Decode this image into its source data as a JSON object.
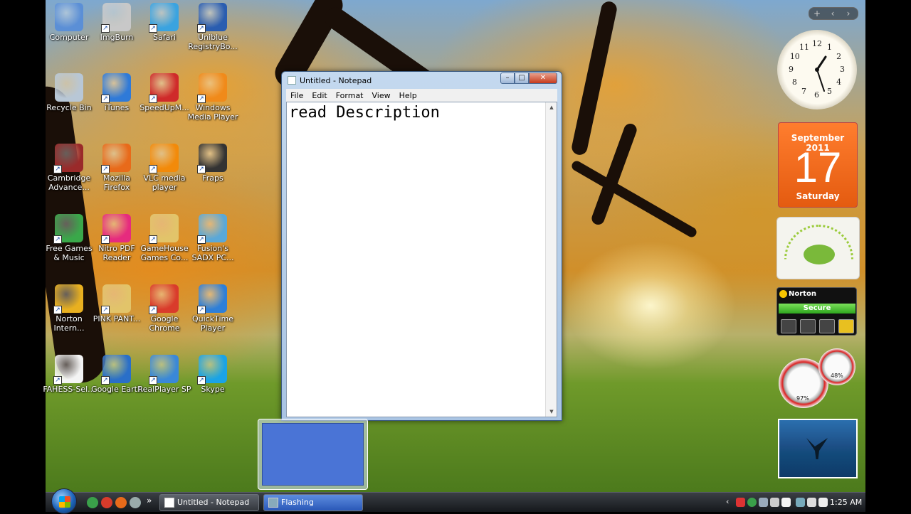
{
  "desktop": {
    "icons": [
      {
        "label": "Computer",
        "icon": "computer-icon",
        "color": "#5b8fd6"
      },
      {
        "label": "ImgBurn",
        "icon": "disc-icon",
        "color": "#c8c8c8"
      },
      {
        "label": "Safari",
        "icon": "compass-icon",
        "color": "#3aa3e0"
      },
      {
        "label": "Uniblue\nRegistryBo...",
        "icon": "shield-icon",
        "color": "#2a5db0"
      },
      {
        "label": "Recycle Bin",
        "icon": "recycle-bin-icon",
        "color": "#b8c7d6"
      },
      {
        "label": "iTunes",
        "icon": "music-note-icon",
        "color": "#2f7ad8"
      },
      {
        "label": "SpeedUpM...",
        "icon": "speedometer-icon",
        "color": "#cf2a2a"
      },
      {
        "label": "Windows\nMedia Player",
        "icon": "play-icon",
        "color": "#f08a1a"
      },
      {
        "label": "Cambridge\nAdvance...",
        "icon": "book-icon",
        "color": "#9a2a2a"
      },
      {
        "label": "Mozilla\nFirefox",
        "icon": "firefox-icon",
        "color": "#e86a1a"
      },
      {
        "label": "VLC media\nplayer",
        "icon": "traffic-cone-icon",
        "color": "#f28a0a"
      },
      {
        "label": "Fraps",
        "icon": "fraps-icon",
        "color": "#333333"
      },
      {
        "label": "Free Games\n& Music",
        "icon": "gift-icon",
        "color": "#3aa84a"
      },
      {
        "label": "Nitro PDF\nReader",
        "icon": "nitro-icon",
        "color": "#e62b7e"
      },
      {
        "label": "GameHouse\nGames Co...",
        "icon": "folder-icon",
        "color": "#e2c46a"
      },
      {
        "label": "Fusion's\nSADX PC...",
        "icon": "globe-icon",
        "color": "#5aa8d8"
      },
      {
        "label": "Norton\nIntern...",
        "icon": "internet-globe-icon",
        "color": "#e8b020"
      },
      {
        "label": "PINK PANT...",
        "icon": "folder-icon",
        "color": "#e2c46a"
      },
      {
        "label": "Google\nChrome",
        "icon": "chrome-icon",
        "color": "#d93b2b"
      },
      {
        "label": "QuickTime\nPlayer",
        "icon": "quicktime-icon",
        "color": "#2e7fd8"
      },
      {
        "label": "FAHESS-Sel...",
        "icon": "document-icon",
        "color": "#f4f4f4"
      },
      {
        "label": "Google Earth",
        "icon": "earth-icon",
        "color": "#2a6fc8"
      },
      {
        "label": "RealPlayer SP",
        "icon": "realplayer-icon",
        "color": "#3a88d8"
      },
      {
        "label": "Skype",
        "icon": "skype-icon",
        "color": "#1aa3e6"
      }
    ]
  },
  "notepad": {
    "title": "Untitled - Notepad",
    "menu": [
      "File",
      "Edit",
      "Format",
      "View",
      "Help"
    ],
    "content": "read Description",
    "buttons": {
      "minimize": "–",
      "maximize": "□",
      "close": "✕"
    }
  },
  "gadgets": {
    "toolbar": [
      "+",
      "‹",
      "›"
    ],
    "clock": {
      "numbers": [
        "12",
        "1",
        "2",
        "3",
        "4",
        "5",
        "6",
        "7",
        "8",
        "9",
        "10",
        "11"
      ],
      "time": "1:25"
    },
    "calendar": {
      "month": "September 2011",
      "day": "17",
      "weekday": "Saturday"
    },
    "norton": {
      "brand": "Norton",
      "status": "Secure"
    },
    "meters": {
      "cpu": "97%",
      "memory": "48%"
    }
  },
  "taskbar": {
    "windows": [
      {
        "label": "Untitled - Notepad",
        "icon": "notepad-icon"
      },
      {
        "label": "Flashing",
        "icon": "window-icon"
      }
    ],
    "quick_launch_more": "»",
    "tray_expand": "‹",
    "time": "1:25 AM"
  }
}
